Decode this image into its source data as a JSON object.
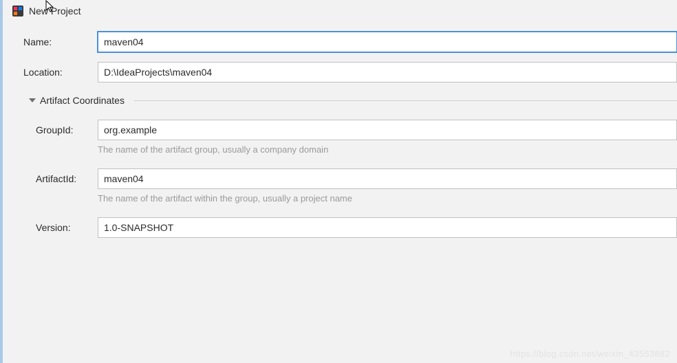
{
  "window": {
    "title": "New Project"
  },
  "fields": {
    "name": {
      "label": "Name:",
      "value": "maven04"
    },
    "location": {
      "label": "Location:",
      "value": "D:\\IdeaProjects\\maven04"
    }
  },
  "artifactSection": {
    "title": "Artifact Coordinates",
    "groupId": {
      "label": "GroupId:",
      "value": "org.example",
      "hint": "The name of the artifact group, usually a company domain"
    },
    "artifactId": {
      "label": "ArtifactId:",
      "value": "maven04",
      "hint": "The name of the artifact within the group, usually a project name"
    },
    "version": {
      "label": "Version:",
      "value": "1.0-SNAPSHOT"
    }
  },
  "watermark": "https://blog.csdn.net/weixin_43553882"
}
